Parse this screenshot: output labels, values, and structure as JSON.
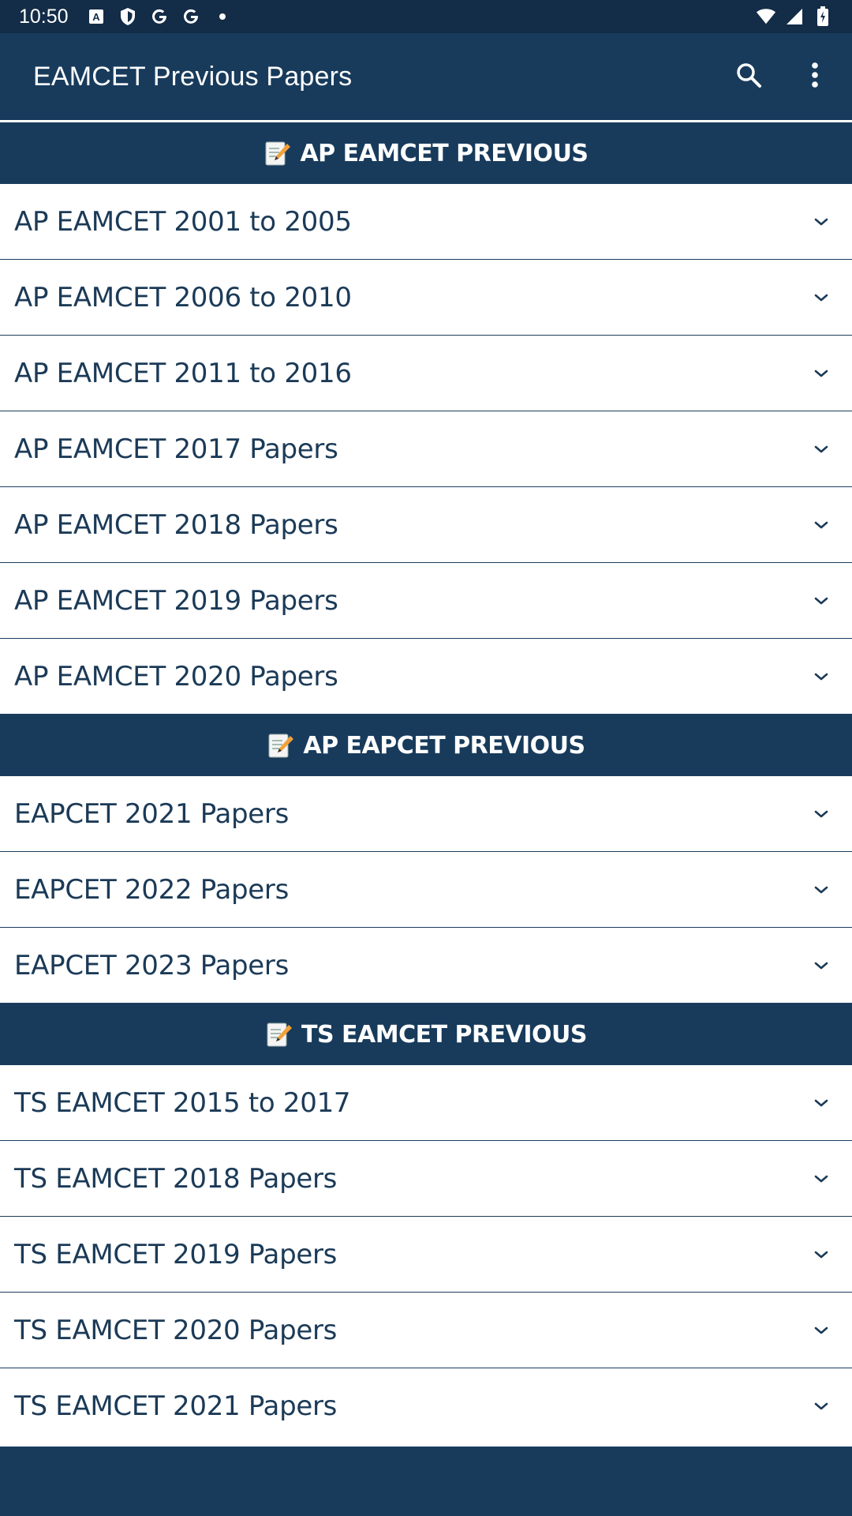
{
  "status_bar": {
    "time": "10:50",
    "icons": [
      "a-box-icon",
      "shield-icon",
      "google-icon",
      "google-icon",
      "dot-icon"
    ],
    "right_icons": [
      "wifi-icon",
      "signal-icon",
      "battery-icon"
    ]
  },
  "app_bar": {
    "title": "EAMCET Previous Papers",
    "actions": [
      "search-icon",
      "more-vert-icon"
    ]
  },
  "colors": {
    "primary": "#183b5c",
    "status": "#132c47",
    "text": "#1b3a57"
  },
  "sections": [
    {
      "emoji": "📝",
      "title": "AP EAMCET PREVIOUS",
      "items": [
        "AP EAMCET 2001 to 2005",
        "AP EAMCET 2006 to 2010",
        "AP EAMCET 2011 to 2016",
        "AP EAMCET 2017 Papers",
        "AP EAMCET 2018 Papers",
        "AP EAMCET 2019 Papers",
        "AP EAMCET 2020 Papers"
      ]
    },
    {
      "emoji": "📝",
      "title": "AP EAPCET PREVIOUS",
      "items": [
        "EAPCET 2021 Papers",
        "EAPCET 2022 Papers",
        "EAPCET 2023 Papers"
      ]
    },
    {
      "emoji": "📝",
      "title": "TS EAMCET PREVIOUS",
      "items": [
        "TS EAMCET 2015 to 2017",
        "TS EAMCET 2018 Papers",
        "TS EAMCET 2019 Papers",
        "TS EAMCET 2020 Papers",
        "TS EAMCET 2021 Papers"
      ]
    }
  ]
}
